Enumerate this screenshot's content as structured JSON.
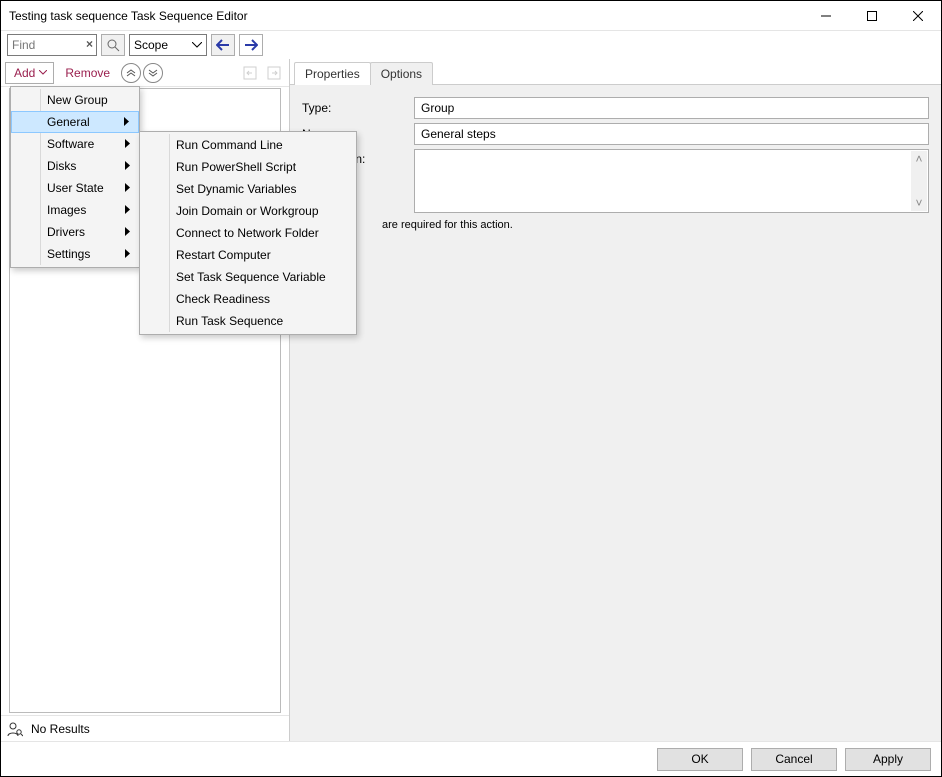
{
  "title": "Testing task sequence Task Sequence Editor",
  "toolbar": {
    "find_placeholder": "Find",
    "scope_label": "Scope"
  },
  "left": {
    "add_label": "Add",
    "remove_label": "Remove",
    "status": "No Results"
  },
  "tabs": {
    "properties": "Properties",
    "options": "Options"
  },
  "form": {
    "type_label": "Type:",
    "type_value": "Group",
    "name_label": "Name:",
    "name_value": "General steps",
    "desc_label": "Description:",
    "hint_partial": "are required  for this action."
  },
  "buttons": {
    "ok": "OK",
    "cancel": "Cancel",
    "apply": "Apply"
  },
  "menu1": {
    "items": [
      {
        "label": "New Group",
        "sub": false
      },
      {
        "label": "General",
        "sub": true,
        "selected": true
      },
      {
        "label": "Software",
        "sub": true
      },
      {
        "label": "Disks",
        "sub": true
      },
      {
        "label": "User State",
        "sub": true
      },
      {
        "label": "Images",
        "sub": true
      },
      {
        "label": "Drivers",
        "sub": true
      },
      {
        "label": "Settings",
        "sub": true
      }
    ]
  },
  "menu2": {
    "items": [
      "Run Command Line",
      "Run PowerShell Script",
      "Set Dynamic Variables",
      "Join Domain or Workgroup",
      "Connect to Network Folder",
      "Restart Computer",
      "Set Task Sequence Variable",
      "Check Readiness",
      "Run Task Sequence"
    ]
  }
}
